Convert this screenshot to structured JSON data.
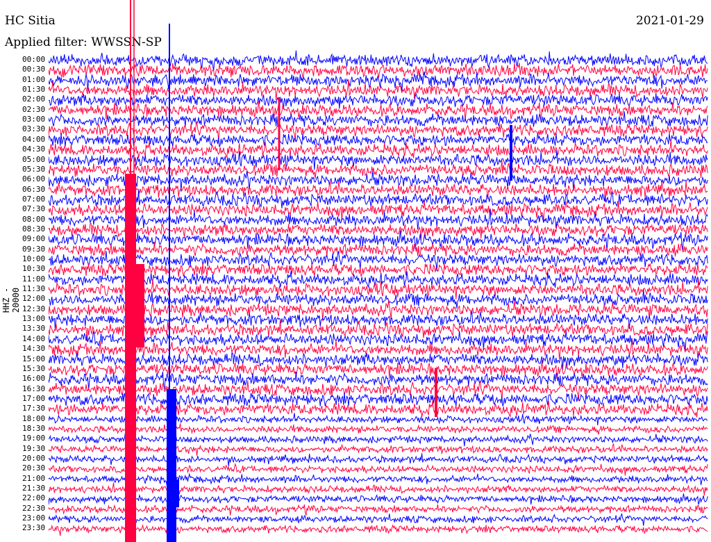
{
  "header": {
    "station": "HC Sitia",
    "date": "2021-01-29",
    "filter_label": "Applied filter: WWSSN-SP"
  },
  "channel_label": "HHZ - 20000",
  "time_labels": [
    "00:00",
    "00:30",
    "01:00",
    "01:30",
    "02:00",
    "02:30",
    "03:00",
    "03:30",
    "04:00",
    "04:30",
    "05:00",
    "05:30",
    "06:00",
    "06:30",
    "07:00",
    "07:30",
    "08:00",
    "08:30",
    "09:00",
    "09:30",
    "10:00",
    "10:30",
    "11:00",
    "11:30",
    "12:00",
    "12:30",
    "13:00",
    "13:30",
    "14:00",
    "14:30",
    "15:00",
    "15:30",
    "16:00",
    "16:30",
    "17:00",
    "17:30",
    "18:00",
    "18:30",
    "19:00",
    "19:30",
    "20:00",
    "20:30",
    "21:00",
    "21:30",
    "22:00",
    "22:30",
    "23:00",
    "23:30"
  ],
  "colors": {
    "trace_a": "#0000ff",
    "trace_b": "#ff0040",
    "event_line": "#ff0040"
  }
}
